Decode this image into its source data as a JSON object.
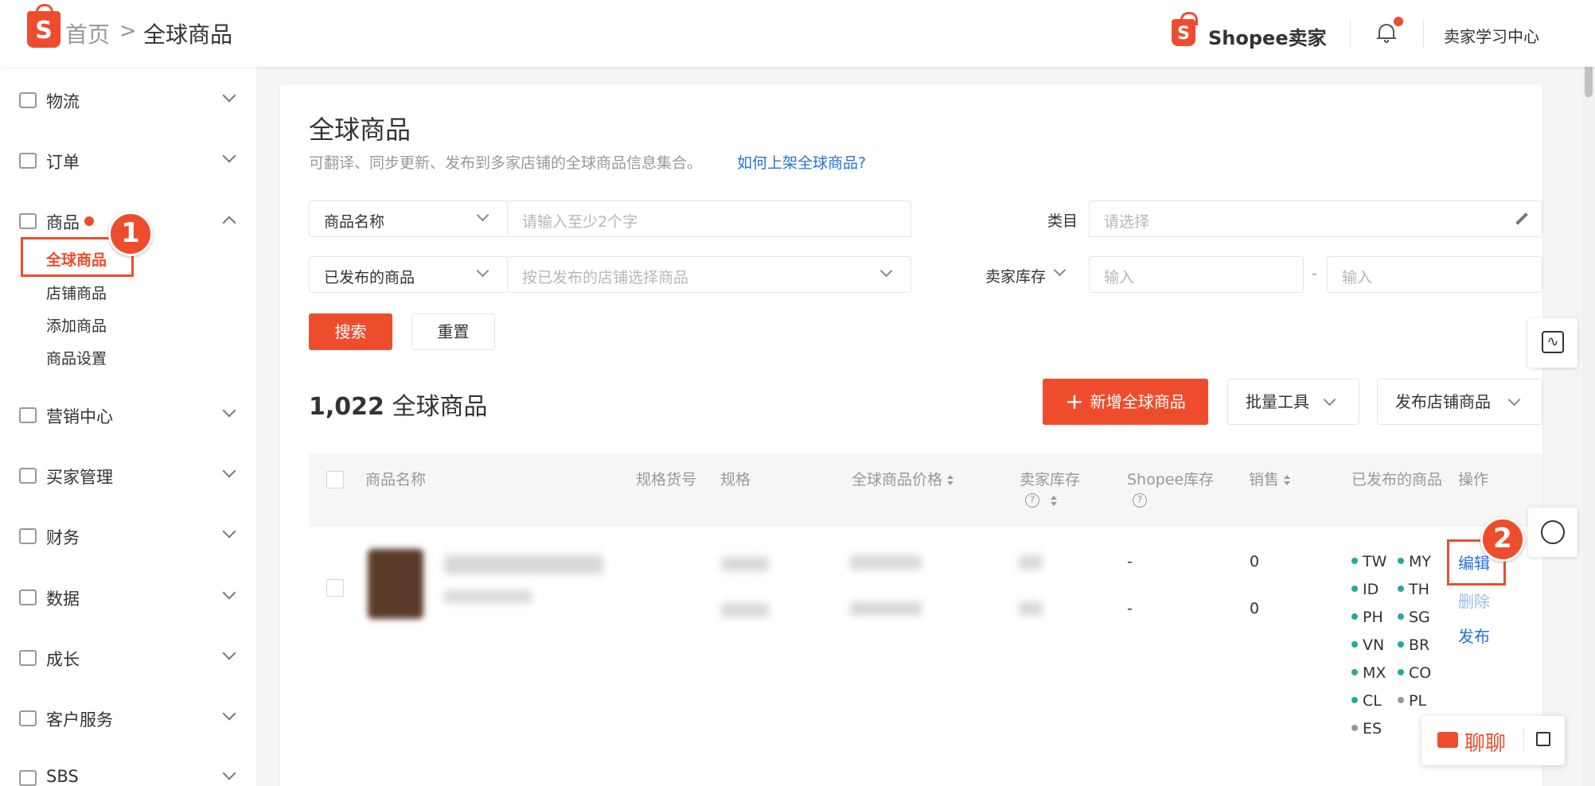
{
  "header": {
    "logo_letter": "S",
    "breadcrumb_home": "首页",
    "breadcrumb_separator": ">",
    "breadcrumb_current": "全球商品",
    "brand_name": "Shopee卖家",
    "learning_center": "卖家学习中心",
    "brand_color": "#ee4d2d"
  },
  "sidebar": {
    "groups": [
      {
        "label": "物流",
        "icon": "truck-icon"
      },
      {
        "label": "订单",
        "icon": "clipboard-icon"
      },
      {
        "label": "商品",
        "icon": "bag-icon"
      },
      {
        "label": "营销中心",
        "icon": "tag-icon"
      },
      {
        "label": "买家管理",
        "icon": "users-icon"
      },
      {
        "label": "财务",
        "icon": "wallet-icon"
      },
      {
        "label": "数据",
        "icon": "chart-icon"
      },
      {
        "label": "成长",
        "icon": "medal-icon"
      },
      {
        "label": "客户服务",
        "icon": "headset-icon"
      },
      {
        "label": "SBS",
        "icon": "warehouse-icon"
      }
    ],
    "product_subitems": [
      "全球商品",
      "店铺商品",
      "添加商品",
      "商品设置"
    ]
  },
  "annotations": {
    "step1": "1",
    "step2": "2"
  },
  "main": {
    "title": "全球商品",
    "description": "可翻译、同步更新、发布到多家店铺的全球商品信息集合。",
    "help_link": "如何上架全球商品?",
    "filters": {
      "name_select": "商品名称",
      "name_placeholder": "请输入至少2个字",
      "category_label": "类目",
      "category_placeholder": "请选择",
      "published_select": "已发布的商品",
      "shop_placeholder": "按已发布的店铺选择商品",
      "stock_label": "卖家库存",
      "stock_min_placeholder": "输入",
      "stock_range_sep": "-",
      "stock_max_placeholder": "输入",
      "search_button": "搜索",
      "reset_button": "重置"
    },
    "count_number": "1,022",
    "count_label": "全球商品",
    "actions": {
      "add_button": "新增全球商品",
      "bulk_tools": "批量工具",
      "publish_shop": "发布店铺商品"
    },
    "table": {
      "headers": {
        "name": "商品名称",
        "sku": "规格货号",
        "variation": "规格",
        "price": "全球商品价格",
        "seller_stock": "卖家库存",
        "shopee_stock": "Shopee库存",
        "sales": "销售",
        "published": "已发布的商品",
        "operation": "操作"
      },
      "row": {
        "shopee_stock": [
          "-",
          "-"
        ],
        "sales": [
          "0",
          "0"
        ],
        "regions": [
          {
            "code": "TW",
            "status": "active"
          },
          {
            "code": "MY",
            "status": "active"
          },
          {
            "code": "ID",
            "status": "active"
          },
          {
            "code": "TH",
            "status": "active"
          },
          {
            "code": "PH",
            "status": "active"
          },
          {
            "code": "SG",
            "status": "active"
          },
          {
            "code": "VN",
            "status": "active"
          },
          {
            "code": "BR",
            "status": "active"
          },
          {
            "code": "MX",
            "status": "active"
          },
          {
            "code": "CO",
            "status": "active"
          },
          {
            "code": "CL",
            "status": "active"
          },
          {
            "code": "PL",
            "status": "inactive"
          },
          {
            "code": "ES",
            "status": "inactive"
          }
        ],
        "ops": {
          "edit": "编辑",
          "delete": "删除",
          "publish": "发布"
        }
      }
    }
  },
  "chat": {
    "label": "聊聊"
  },
  "colors": {
    "active_dot": "#26aa99",
    "inactive_dot": "#999999",
    "link": "#2673dd"
  }
}
